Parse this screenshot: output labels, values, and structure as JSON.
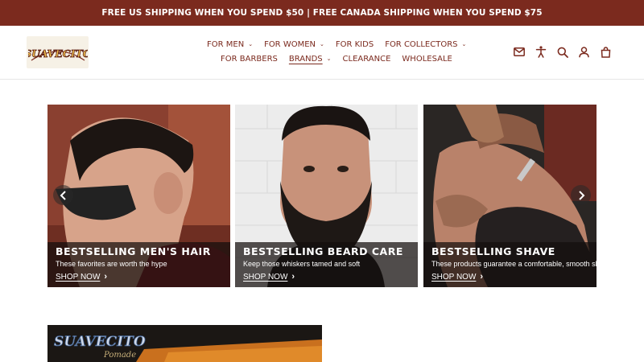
{
  "announcement": "FREE US SHIPPING WHEN YOU SPEND $50 | FREE CANADA SHIPPING WHEN YOU SPEND $75",
  "logo": {
    "text": "SUAVECITO",
    "icon": "brand-logo"
  },
  "nav": {
    "row1": [
      {
        "label": "FOR MEN",
        "dropdown": true
      },
      {
        "label": "FOR WOMEN",
        "dropdown": true
      },
      {
        "label": "FOR KIDS",
        "dropdown": false
      },
      {
        "label": "FOR COLLECTORS",
        "dropdown": true
      }
    ],
    "row2": [
      {
        "label": "FOR BARBERS",
        "dropdown": false
      },
      {
        "label": "BRANDS",
        "dropdown": true,
        "active": true
      },
      {
        "label": "CLEARANCE",
        "dropdown": false
      },
      {
        "label": "WHOLESALE",
        "dropdown": false
      }
    ]
  },
  "header_icons": [
    "mail-icon",
    "accessibility-icon",
    "search-icon",
    "account-icon",
    "cart-icon"
  ],
  "slides": [
    {
      "title": "BESTSELLING MEN'S HAIR",
      "subtitle": "These favorites are worth the hype",
      "cta": "SHOP NOW"
    },
    {
      "title": "BESTSELLING BEARD CARE",
      "subtitle": "Keep those whiskers tamed and soft",
      "cta": "SHOP NOW"
    },
    {
      "title": "BESTSELLING SHAVE",
      "subtitle": "These products guarantee a comfortable, smooth shave",
      "cta": "SHOP NOW"
    }
  ],
  "promo": {
    "logo_text": "SUAVECITO",
    "logo_sub": "Pomade"
  },
  "colors": {
    "brand": "#7b2a1e",
    "caption_bg": "#140e0c"
  }
}
